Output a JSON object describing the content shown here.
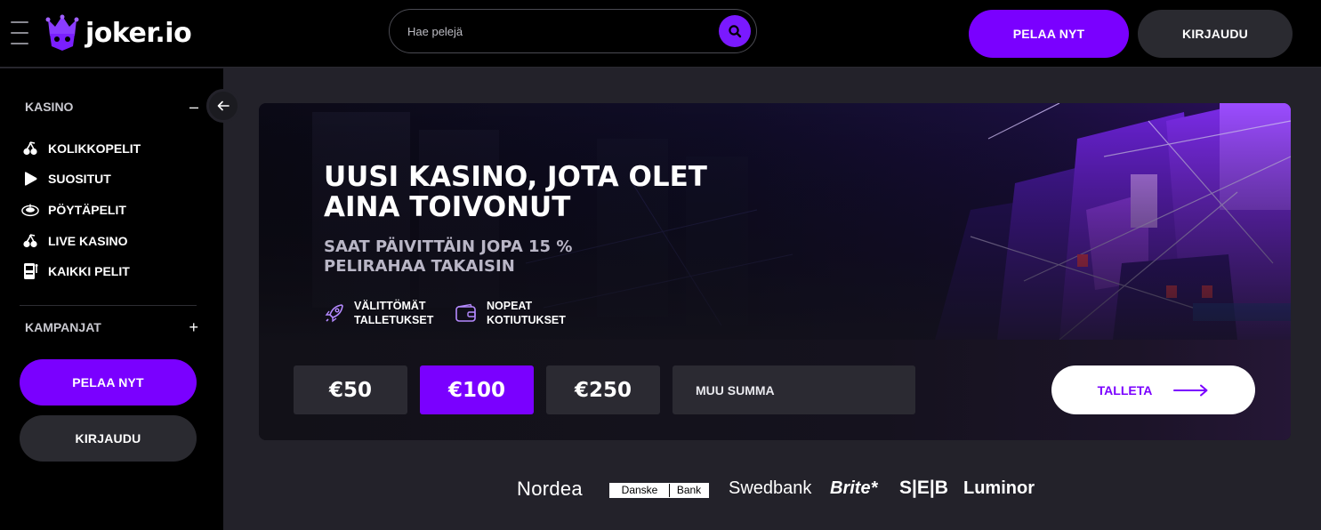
{
  "header": {
    "logo_text": "joker.io",
    "search_placeholder": "Hae pelejä",
    "play_label": "PELAA NYT",
    "login_label": "KIRJAUDU"
  },
  "sidebar": {
    "casino_heading": "KASINO",
    "casino_toggle": "–",
    "items": [
      {
        "label": "KOLIKKOPELIT",
        "icon": "cherries-icon"
      },
      {
        "label": "SUOSITUT",
        "icon": "play-icon"
      },
      {
        "label": "PÖYTÄPELIT",
        "icon": "roulette-icon"
      },
      {
        "label": "LIVE KASINO",
        "icon": "cherries-icon"
      },
      {
        "label": "KAIKKI PELIT",
        "icon": "slot-machine-icon"
      }
    ],
    "campaigns_heading": "KAMPANJAT",
    "campaigns_toggle": "+",
    "play_label": "PELAA NYT",
    "login_label": "KIRJAUDU"
  },
  "hero": {
    "title": "UUSI KASINO, JOTA OLET AINA TOIVONUT",
    "subtitle": "SAAT PÄIVITTÄIN JOPA 15 % PELIRAHAA TAKAISIN",
    "features": [
      {
        "line1": "VÄLITTÖMÄT",
        "line2": "TALLETUKSET",
        "icon": "rocket-icon"
      },
      {
        "line1": "NOPEAT",
        "line2": "KOTIUTUKSET",
        "icon": "wallet-icon"
      }
    ],
    "amounts": [
      "€50",
      "€100",
      "€250"
    ],
    "selected_amount": "€100",
    "other_amount_placeholder": "MUU SUMMA",
    "deposit_label": "TALLETA"
  },
  "banks": [
    "Nordea",
    "Danske",
    "Bank",
    "Swedbank",
    "Brite*",
    "S|E|B",
    "Luminor"
  ],
  "colors": {
    "accent": "#7a00ff",
    "background": "#23222a",
    "panel": "#000000"
  }
}
